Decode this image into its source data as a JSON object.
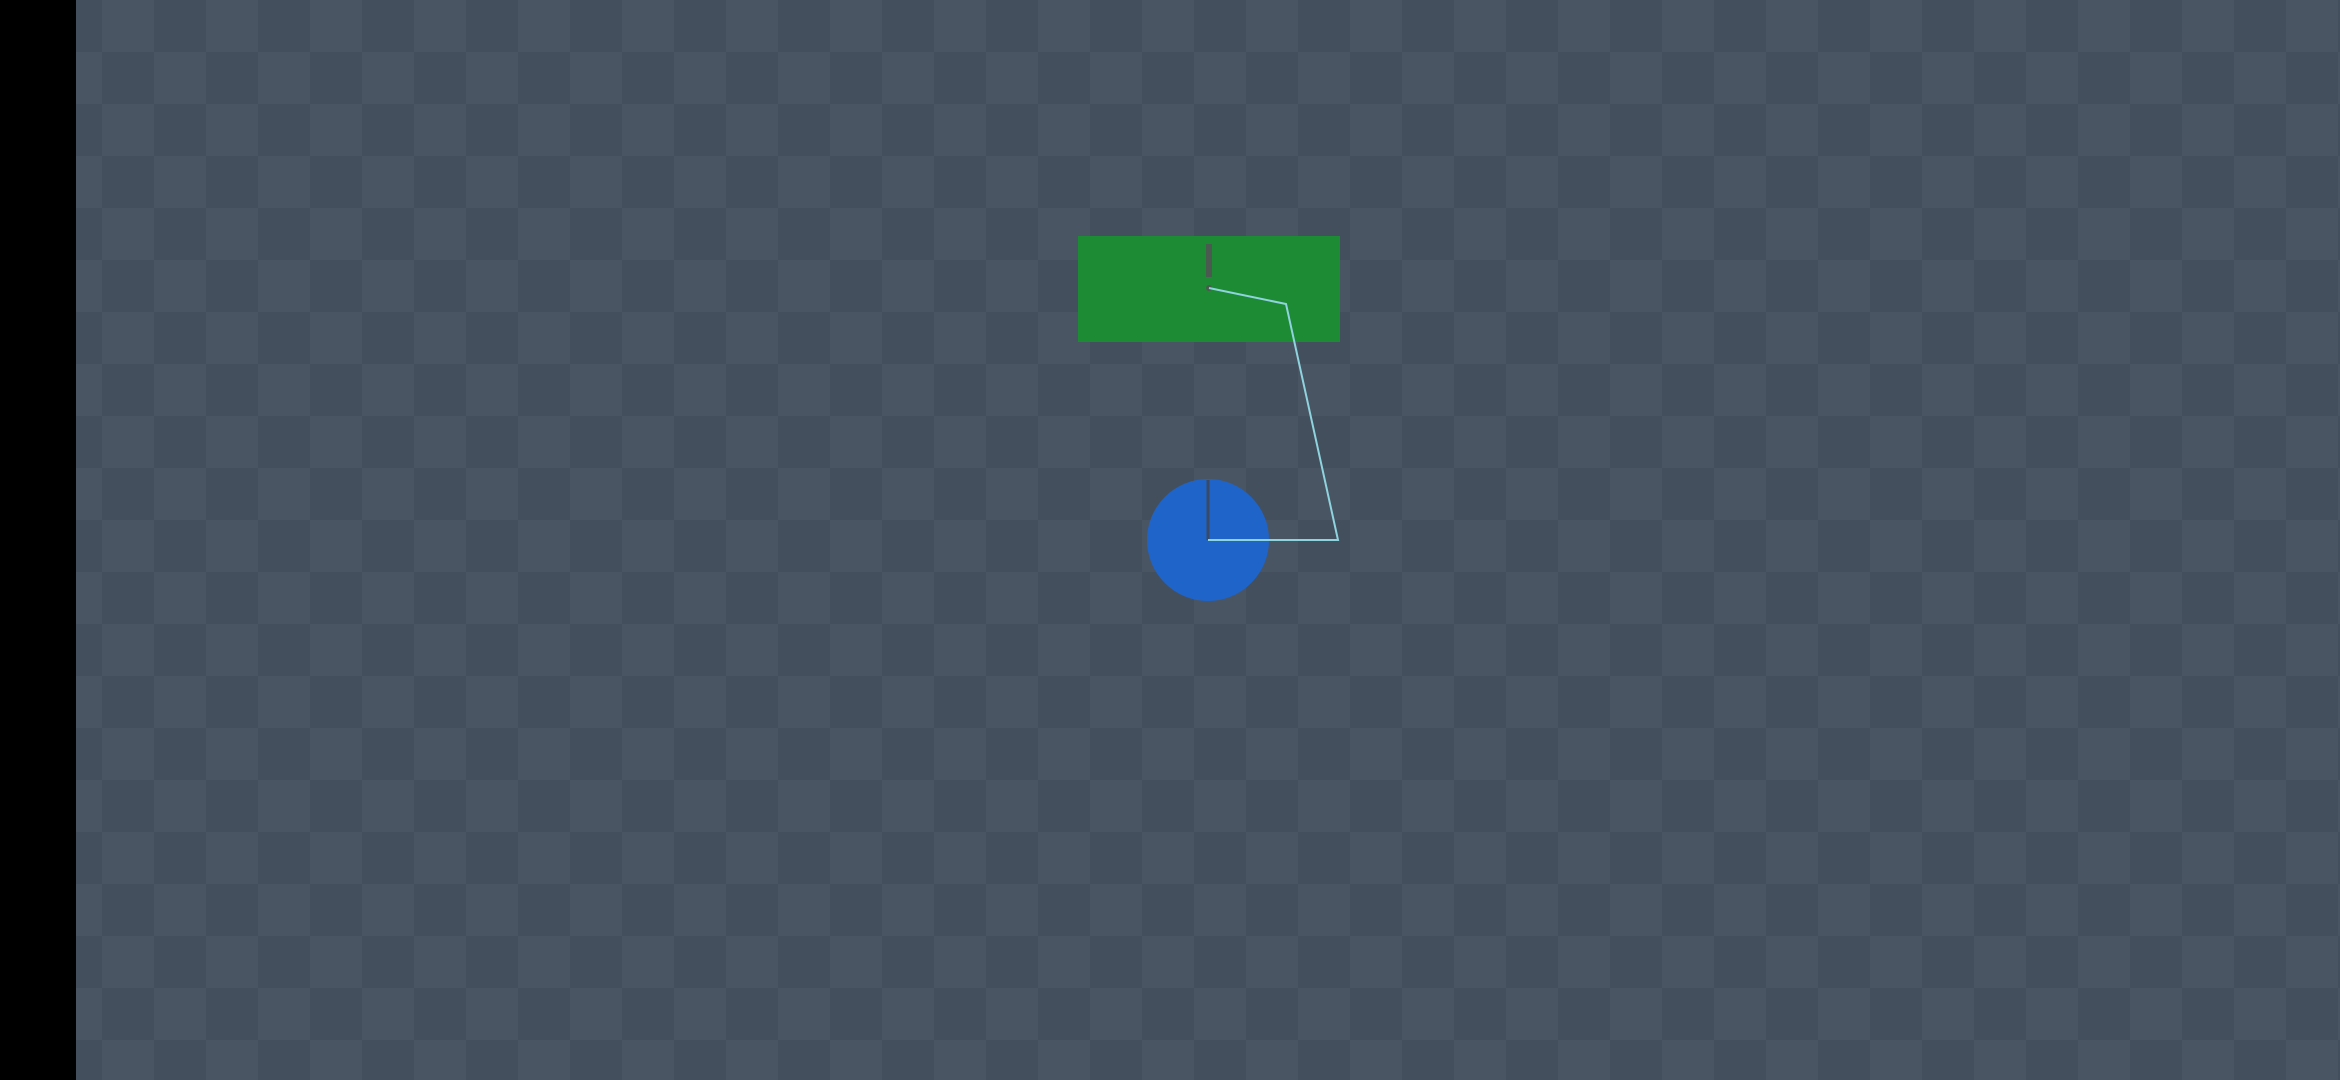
{
  "app": {
    "background_color": "#444f5d",
    "checker_dark": "#414b59",
    "checker_light": "#4a5564",
    "system_bar_color": "#000000"
  },
  "scene": {
    "platform": {
      "color": "#1d8a34",
      "anchor_color": "#4a5a50"
    },
    "ball": {
      "color": "#1f64c8",
      "marker_color": "#3a4a66"
    },
    "joint": {
      "line_color": "#8fd3de"
    }
  }
}
